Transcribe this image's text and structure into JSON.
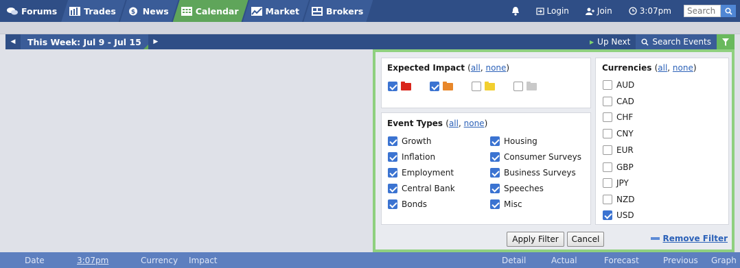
{
  "nav": {
    "tabs": [
      {
        "label": "Forums",
        "icon": "forums-icon"
      },
      {
        "label": "Trades",
        "icon": "trades-icon"
      },
      {
        "label": "News",
        "icon": "news-icon"
      },
      {
        "label": "Calendar",
        "icon": "calendar-icon",
        "active": true
      },
      {
        "label": "Market",
        "icon": "market-icon"
      },
      {
        "label": "Brokers",
        "icon": "brokers-icon"
      }
    ],
    "login": "Login",
    "join": "Join",
    "time": "3:07pm",
    "search_placeholder": "Search"
  },
  "weekbar": {
    "title": "This Week: Jul 9 - Jul 15",
    "up_next": "Up Next",
    "search_events": "Search Events"
  },
  "filter": {
    "impact": {
      "title": "Expected Impact",
      "all": "all",
      "none": "none",
      "levels": [
        {
          "color": "#d9261c",
          "checked": true
        },
        {
          "color": "#e8872a",
          "checked": true
        },
        {
          "color": "#f2cf2f",
          "checked": false
        },
        {
          "color": "#c9c9c9",
          "checked": false
        }
      ]
    },
    "event_types": {
      "title": "Event Types",
      "all": "all",
      "none": "none",
      "col1": [
        {
          "label": "Growth",
          "checked": true
        },
        {
          "label": "Inflation",
          "checked": true
        },
        {
          "label": "Employment",
          "checked": true
        },
        {
          "label": "Central Bank",
          "checked": true
        },
        {
          "label": "Bonds",
          "checked": true
        }
      ],
      "col2": [
        {
          "label": "Housing",
          "checked": true
        },
        {
          "label": "Consumer Surveys",
          "checked": true
        },
        {
          "label": "Business Surveys",
          "checked": true
        },
        {
          "label": "Speeches",
          "checked": true
        },
        {
          "label": "Misc",
          "checked": true
        }
      ]
    },
    "currencies": {
      "title": "Currencies",
      "all": "all",
      "none": "none",
      "items": [
        {
          "label": "AUD",
          "checked": false
        },
        {
          "label": "CAD",
          "checked": false
        },
        {
          "label": "CHF",
          "checked": false
        },
        {
          "label": "CNY",
          "checked": false
        },
        {
          "label": "EUR",
          "checked": false
        },
        {
          "label": "GBP",
          "checked": false
        },
        {
          "label": "JPY",
          "checked": false
        },
        {
          "label": "NZD",
          "checked": false
        },
        {
          "label": "USD",
          "checked": true
        }
      ]
    },
    "apply_label": "Apply Filter",
    "cancel_label": "Cancel",
    "remove_label": "Remove Filter"
  },
  "columns": {
    "date": "Date",
    "time": "3:07pm",
    "currency": "Currency",
    "impact": "Impact",
    "detail": "Detail",
    "actual": "Actual",
    "forecast": "Forecast",
    "previous": "Previous",
    "graph": "Graph"
  }
}
